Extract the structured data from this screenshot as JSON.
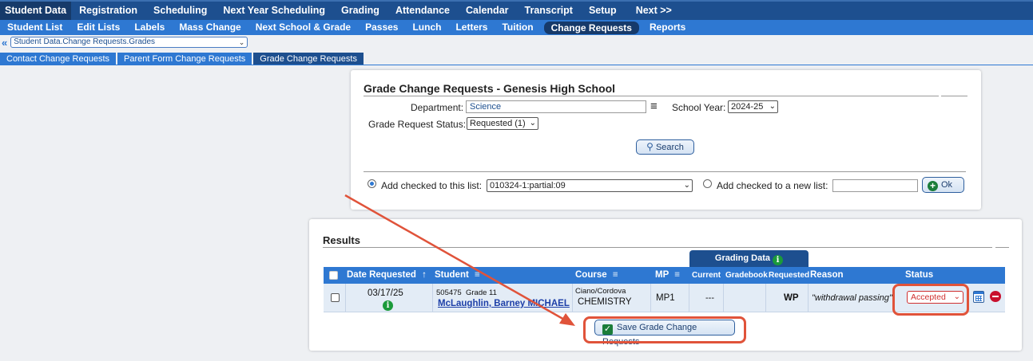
{
  "nav_primary": [
    "Student Data",
    "Registration",
    "Scheduling",
    "Next Year Scheduling",
    "Grading",
    "Attendance",
    "Calendar",
    "Transcript",
    "Setup",
    "Next >>"
  ],
  "nav_secondary": [
    "Student List",
    "Edit Lists",
    "Labels",
    "Mass Change",
    "Next School & Grade",
    "Passes",
    "Lunch",
    "Letters",
    "Tuition",
    "Change Requests",
    "Reports"
  ],
  "breadcrumb": {
    "back_icon": "«",
    "select_value": "Student Data.Change Requests.Grades"
  },
  "subtabs": [
    "Contact Change Requests",
    "Parent Form Change Requests",
    "Grade Change Requests"
  ],
  "search_panel": {
    "title": "Grade Change Requests - Genesis High School",
    "department_label": "Department:",
    "department_value": "Science",
    "school_year_label": "School Year:",
    "school_year_value": "2024-25",
    "status_label": "Grade Request Status:",
    "status_value": "Requested (1)",
    "search_button": "Search",
    "add_to_list_label": "Add checked to this list:",
    "add_to_list_value": "010324-1:partial:09",
    "add_new_list_label": "Add checked to a new list:",
    "new_list_value": "",
    "ok_button": "Ok"
  },
  "results": {
    "title": "Results",
    "grading_data_label": "Grading Data",
    "columns": {
      "date_requested": "Date Requested",
      "date_sort_icon": "↑",
      "student": "Student",
      "course": "Course",
      "mp": "MP",
      "current": "Current",
      "gradebook": "Gradebook",
      "requested": "Requested",
      "reason": "Reason",
      "status": "Status"
    },
    "row": {
      "date": "03/17/25",
      "student_id": "505475",
      "grade": "Grade 11",
      "student_name": "McLaughlin, Barney MICHAEL",
      "teacher": "Ciano/Cordova",
      "course": "CHEMISTRY",
      "mp": "MP1",
      "current": "---",
      "gradebook": "",
      "requested": "WP",
      "reason": "\"withdrawal passing\"",
      "status": "Accepted"
    },
    "save_button": "Save Grade Change Requests"
  },
  "colors": {
    "nav_dark": "#1d4f8f",
    "nav_blue": "#2e78d2",
    "annotation": "#e0533a",
    "status_red": "#d03030"
  }
}
